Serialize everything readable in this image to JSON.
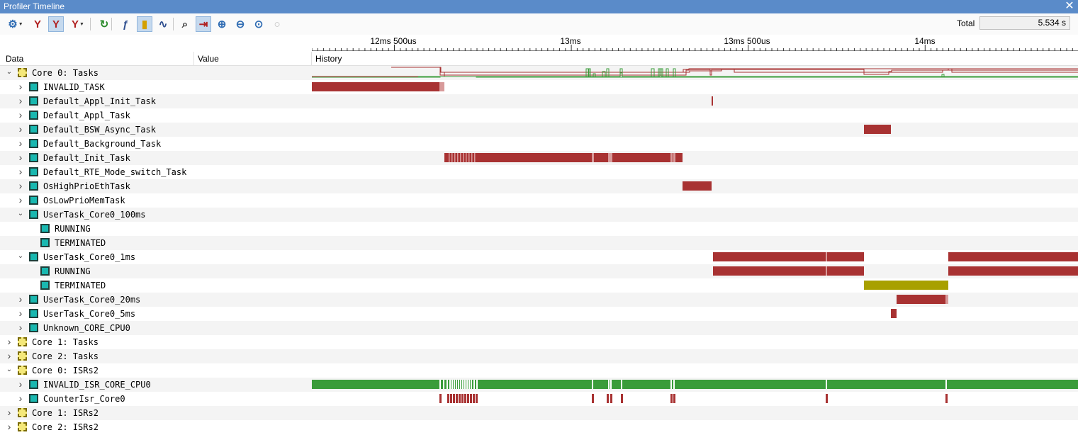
{
  "window": {
    "title": "Profiler Timeline",
    "close_glyph": "✕"
  },
  "toolbar": {
    "buttons": [
      {
        "name": "settings-gear-icon",
        "glyph": "⚙",
        "dropdown": true
      },
      {
        "name": "filter-icon",
        "glyph": "Y",
        "dropdown": false
      },
      {
        "name": "filter-active-icon",
        "glyph": "Y",
        "dropdown": false,
        "active": true
      },
      {
        "name": "filter-add-icon",
        "glyph": "Y",
        "dropdown": true
      },
      {
        "name": "refresh-icon",
        "glyph": "↻",
        "dropdown": false
      },
      {
        "name": "function-icon",
        "glyph": "ƒ",
        "dropdown": false
      },
      {
        "name": "bookmark-icon",
        "glyph": "▮",
        "dropdown": false,
        "active": true
      },
      {
        "name": "graph-icon",
        "glyph": "∿",
        "dropdown": false
      },
      {
        "name": "binoculars-icon",
        "glyph": "⌕",
        "dropdown": false
      },
      {
        "name": "zoom-fit-icon",
        "glyph": "⇥",
        "dropdown": false,
        "active": true
      },
      {
        "name": "zoom-in-icon",
        "glyph": "⊕",
        "dropdown": false
      },
      {
        "name": "zoom-out-icon",
        "glyph": "⊖",
        "dropdown": false
      },
      {
        "name": "zoom-all-icon",
        "glyph": "⊙",
        "dropdown": false
      },
      {
        "name": "zoom-disabled-icon",
        "glyph": "○",
        "dropdown": false
      }
    ],
    "total_label": "Total",
    "total_value": "5.534 s"
  },
  "ruler": {
    "labels": [
      "12ms 500us",
      "13ms",
      "13ms 500us",
      "14ms"
    ]
  },
  "columns": {
    "data": "Data",
    "value": "Value",
    "history": "History"
  },
  "rows": [
    {
      "label": "Core 0: Tasks",
      "level": 0,
      "expanded": true,
      "icon": "core"
    },
    {
      "label": "INVALID_TASK",
      "level": 1,
      "expanded": false,
      "icon": "task"
    },
    {
      "label": "Default_Appl_Init_Task",
      "level": 1,
      "expanded": false,
      "icon": "task"
    },
    {
      "label": "Default_Appl_Task",
      "level": 1,
      "expanded": false,
      "icon": "task"
    },
    {
      "label": "Default_BSW_Async_Task",
      "level": 1,
      "expanded": false,
      "icon": "task"
    },
    {
      "label": "Default_Background_Task",
      "level": 1,
      "expanded": false,
      "icon": "task"
    },
    {
      "label": "Default_Init_Task",
      "level": 1,
      "expanded": false,
      "icon": "task"
    },
    {
      "label": "Default_RTE_Mode_switch_Task",
      "level": 1,
      "expanded": false,
      "icon": "task"
    },
    {
      "label": "OsHighPrioEthTask",
      "level": 1,
      "expanded": false,
      "icon": "task"
    },
    {
      "label": "OsLowPrioMemTask",
      "level": 1,
      "expanded": false,
      "icon": "task"
    },
    {
      "label": "UserTask_Core0_100ms",
      "level": 1,
      "expanded": true,
      "icon": "task"
    },
    {
      "label": "RUNNING",
      "level": 2,
      "leaf": true,
      "icon": "task"
    },
    {
      "label": "TERMINATED",
      "level": 2,
      "leaf": true,
      "icon": "task"
    },
    {
      "label": "UserTask_Core0_1ms",
      "level": 1,
      "expanded": true,
      "icon": "task"
    },
    {
      "label": "RUNNING",
      "level": 2,
      "leaf": true,
      "icon": "task"
    },
    {
      "label": "TERMINATED",
      "level": 2,
      "leaf": true,
      "icon": "task"
    },
    {
      "label": "UserTask_Core0_20ms",
      "level": 1,
      "expanded": false,
      "icon": "task"
    },
    {
      "label": "UserTask_Core0_5ms",
      "level": 1,
      "expanded": false,
      "icon": "task"
    },
    {
      "label": "Unknown_CORE_CPU0",
      "level": 1,
      "expanded": false,
      "icon": "task"
    },
    {
      "label": "Core 1: Tasks",
      "level": 0,
      "expanded": false,
      "icon": "core"
    },
    {
      "label": "Core 2: Tasks",
      "level": 0,
      "expanded": false,
      "icon": "core"
    },
    {
      "label": "Core 0: ISRs2",
      "level": 0,
      "expanded": true,
      "icon": "core"
    },
    {
      "label": "INVALID_ISR_CORE_CPU0",
      "level": 1,
      "expanded": false,
      "icon": "task"
    },
    {
      "label": "CounterIsr_Core0",
      "level": 1,
      "expanded": false,
      "icon": "task"
    },
    {
      "label": "Core 1: ISRs2",
      "level": 0,
      "expanded": false,
      "icon": "core"
    },
    {
      "label": "Core 2: ISRs2",
      "level": 0,
      "expanded": false,
      "icon": "core"
    }
  ],
  "colors": {
    "task_bar": "#a83232",
    "task_bar_light": "#d89a9a",
    "terminated_bar": "#a8a000",
    "isr_bar": "#3a9c3a",
    "task_line": "#a83232",
    "isr_line": "#3a9c3a",
    "titlebar": "#5a8bc9"
  }
}
